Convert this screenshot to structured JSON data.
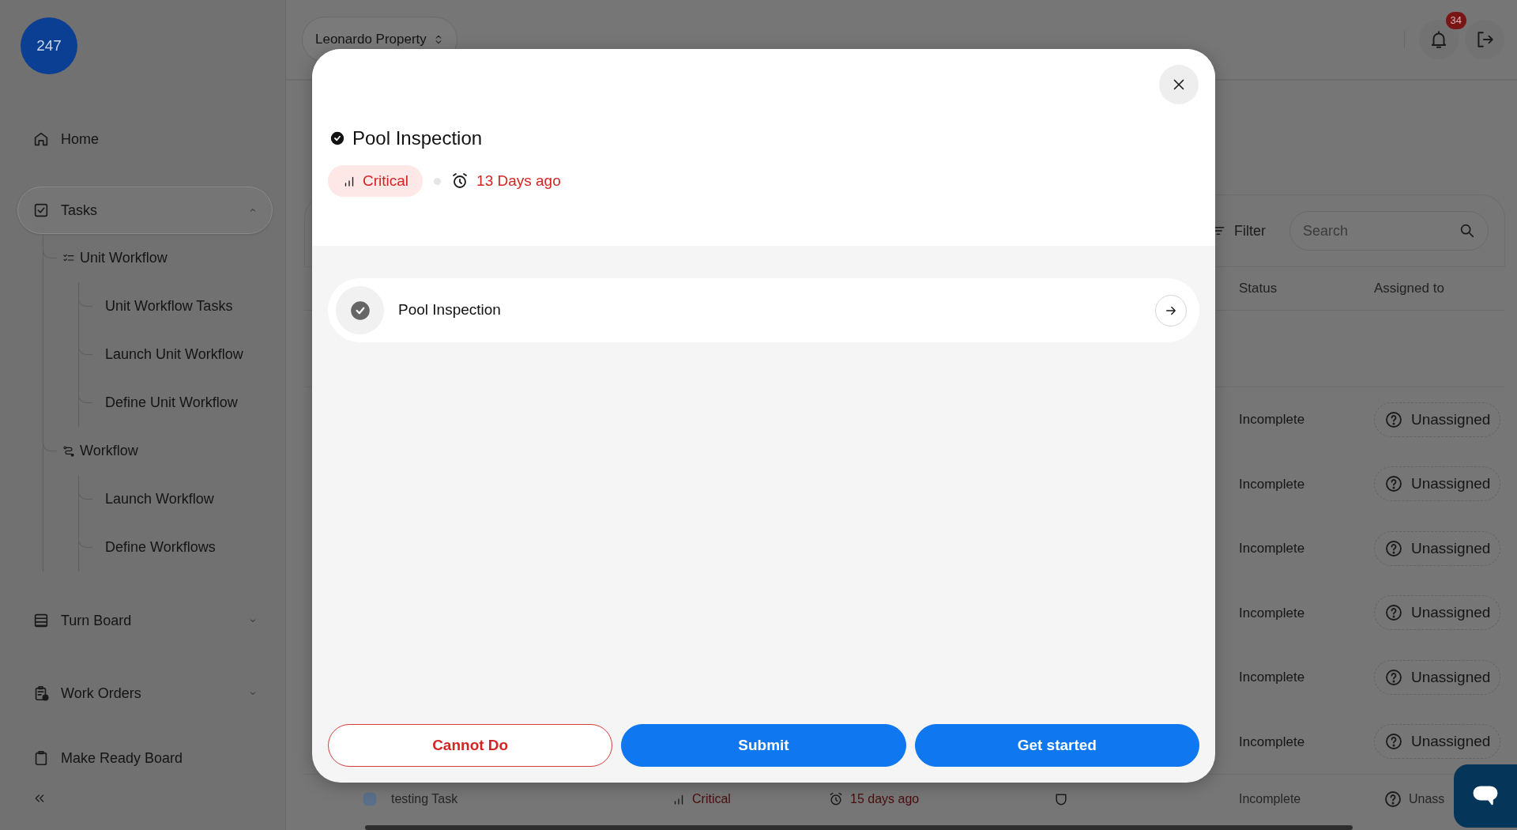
{
  "sidebar": {
    "logo": "247",
    "items": [
      {
        "label": "Home",
        "selected": false
      },
      {
        "label": "Tasks",
        "selected": true,
        "expanded": true,
        "children": [
          {
            "label": "Unit Workflow",
            "children": [
              {
                "label": "Unit Workflow Tasks"
              },
              {
                "label": "Launch Unit Workflow"
              },
              {
                "label": "Define Unit Workflow"
              }
            ]
          },
          {
            "label": "Workflow",
            "children": [
              {
                "label": "Launch Workflow"
              },
              {
                "label": "Define Workflows"
              }
            ]
          }
        ]
      },
      {
        "label": "Turn Board",
        "selected": false,
        "expanded": false
      },
      {
        "label": "Work Orders",
        "selected": false,
        "expanded": false
      },
      {
        "label": "Make Ready Board",
        "selected": false
      }
    ]
  },
  "header": {
    "property": "Leonardo Property",
    "notifications": "34"
  },
  "page": {
    "filter": "Filter",
    "search": {
      "placeholder": "Search"
    },
    "table": {
      "columns": [
        "Status",
        "Assigned to"
      ],
      "rows": [
        {
          "status": "Incomplete",
          "assignee": "Unassigned"
        },
        {
          "status": "Incomplete",
          "assignee": "Unassigned"
        },
        {
          "status": "Incomplete",
          "assignee": "Unassigned"
        },
        {
          "status": "Incomplete",
          "assignee": "Unassigned"
        },
        {
          "status": "Incomplete",
          "assignee": "Unassigned"
        },
        {
          "status": "Incomplete",
          "assignee": "Unassigned"
        }
      ],
      "partial_row": {
        "task": "testing Task",
        "priority": "Critical",
        "due": "15 days ago",
        "status": "Incomplete",
        "assignee": "Unass"
      }
    }
  },
  "modal": {
    "title": "Pool Inspection",
    "completed": true,
    "priority": "Critical",
    "due": "13 Days ago",
    "steps": [
      {
        "label": "Pool Inspection",
        "done": true
      }
    ],
    "buttons": [
      {
        "label": "Cannot Do",
        "kind": "outline"
      },
      {
        "label": "Submit",
        "kind": "primary"
      },
      {
        "label": "Get started",
        "kind": "primary"
      }
    ]
  }
}
